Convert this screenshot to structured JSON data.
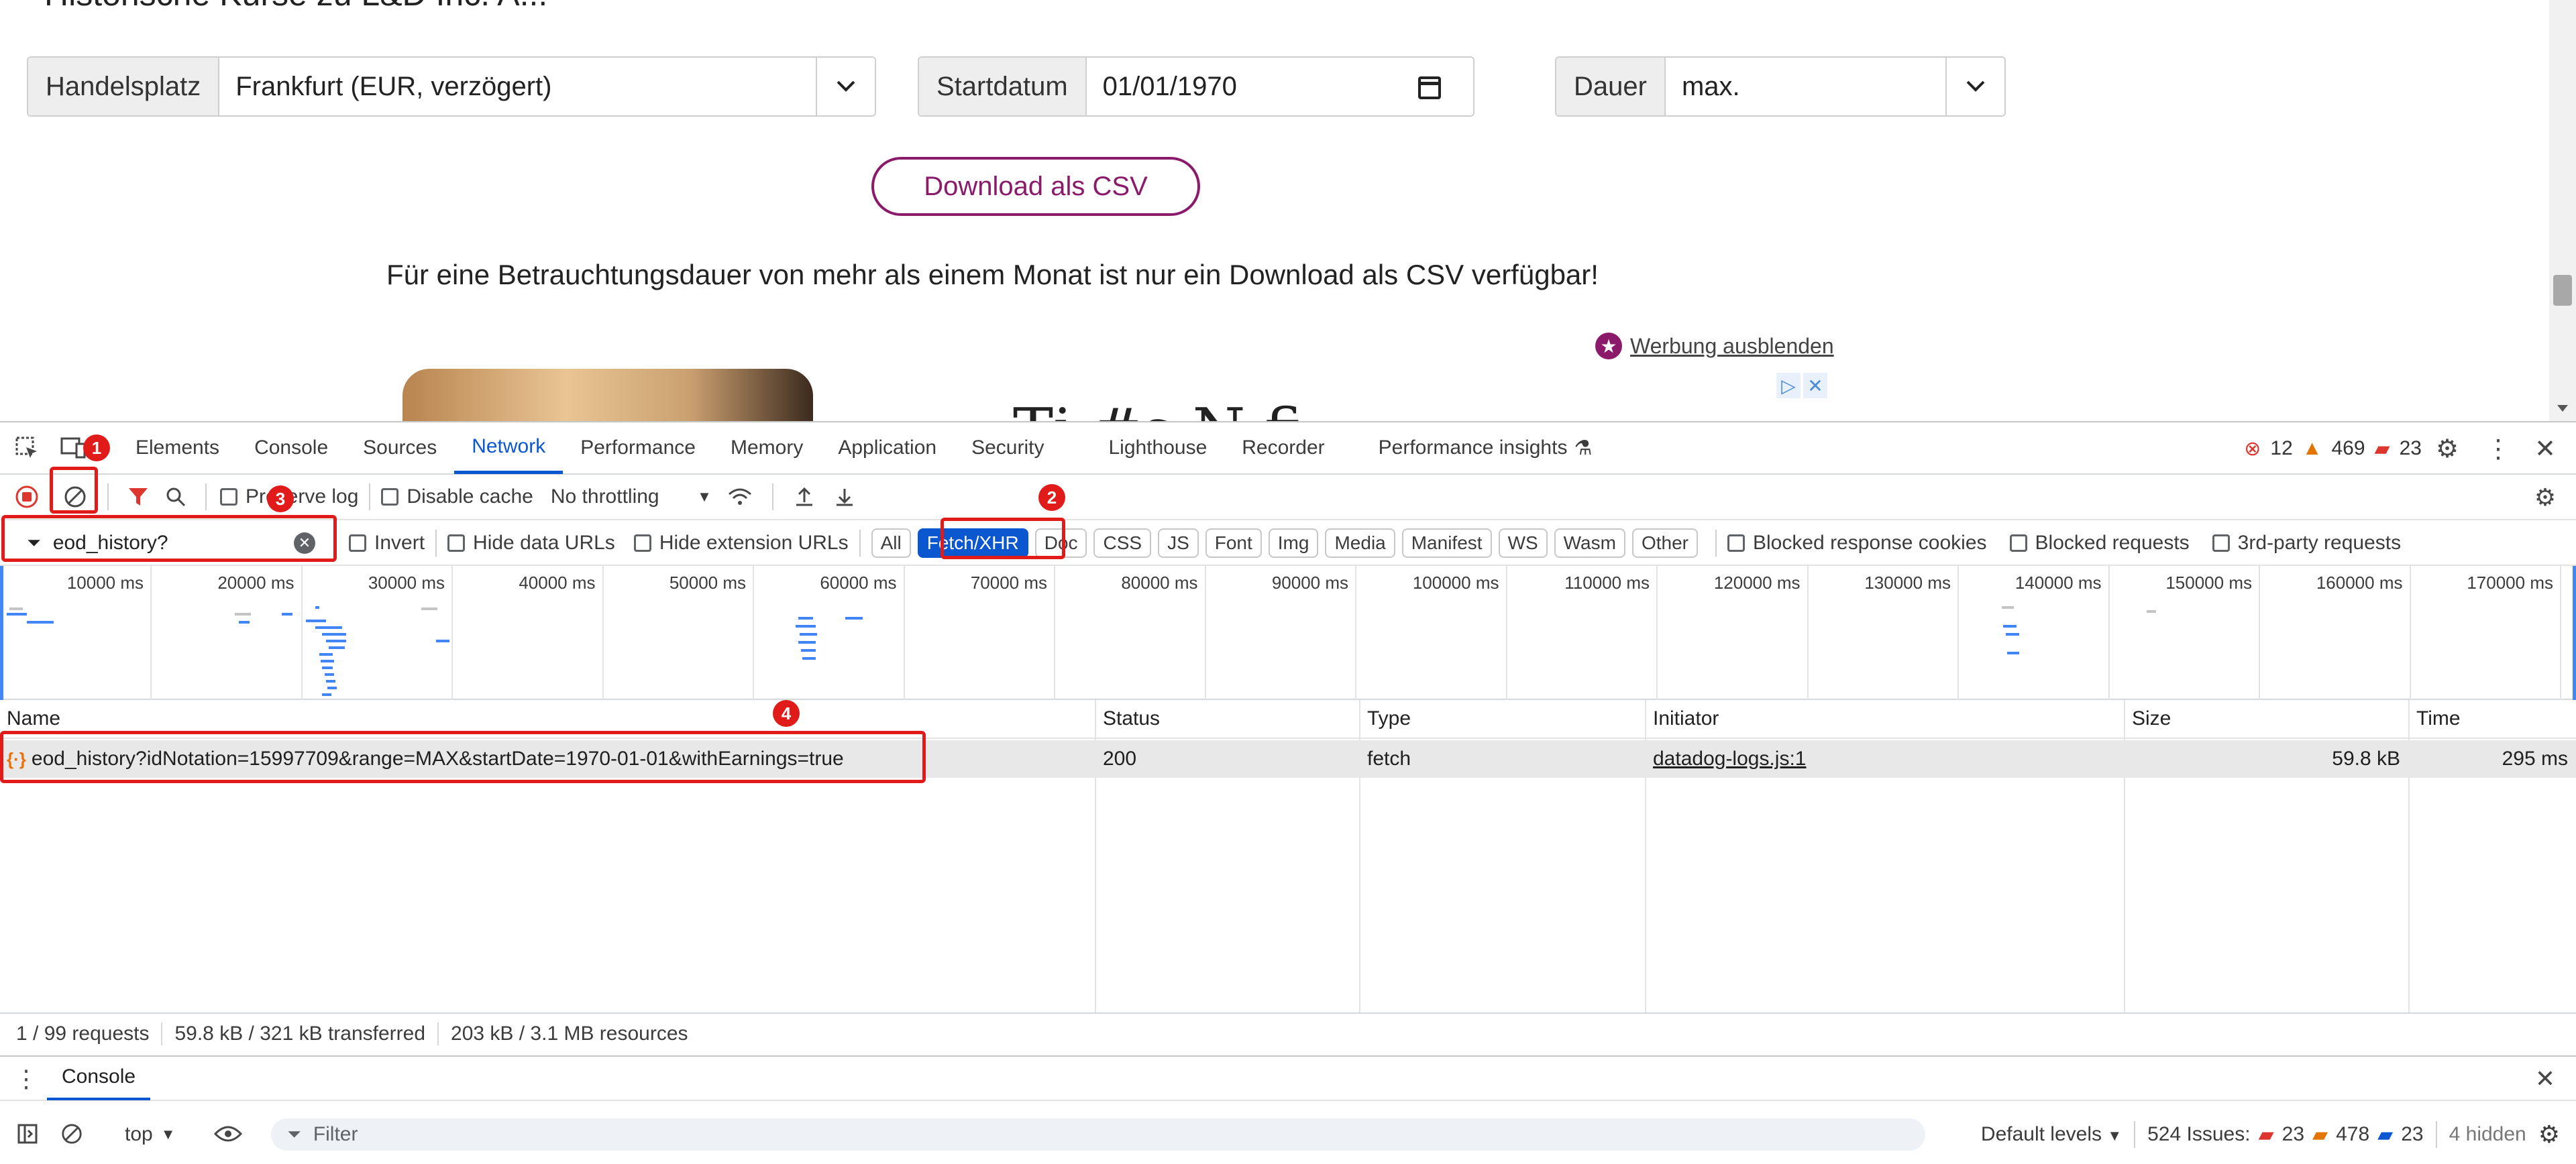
{
  "webpage": {
    "heading": "Historische Kurse zu L&D Inc. A...",
    "exchange": {
      "label": "Handelsplatz",
      "value": "Frankfurt (EUR, verzögert)"
    },
    "start_date": {
      "label": "Startdatum",
      "value": "01/01/1970"
    },
    "duration": {
      "label": "Dauer",
      "value": "max."
    },
    "download_button": "Download als CSV",
    "info_text": "Für eine Betrauchtungsdauer von mehr als einem Monat ist nur ein Download als CSV verfügbar!",
    "ad_hide_link": "Werbung ausblenden",
    "ad_partial_text": "Ti   #s  N   fi"
  },
  "devtools": {
    "tabs": [
      "Elements",
      "Console",
      "Sources",
      "Network",
      "Performance",
      "Memory",
      "Application",
      "Security",
      "Lighthouse",
      "Recorder",
      "Performance insights"
    ],
    "active_tab": "Network",
    "counts": {
      "errors": "12",
      "warnings": "469",
      "messages": "23"
    },
    "toolbar": {
      "preserve_log": "Preserve log",
      "disable_cache": "Disable cache",
      "throttling": "No throttling"
    },
    "filter": {
      "value": "eod_history?",
      "invert": "Invert",
      "hide_data_urls": "Hide data URLs",
      "hide_extension_urls": "Hide extension URLs",
      "types": [
        "All",
        "Fetch/XHR",
        "Doc",
        "CSS",
        "JS",
        "Font",
        "Img",
        "Media",
        "Manifest",
        "WS",
        "Wasm",
        "Other"
      ],
      "active_type": "Fetch/XHR",
      "blocked_response_cookies": "Blocked response cookies",
      "blocked_requests": "Blocked requests",
      "third_party_requests": "3rd-party requests"
    },
    "overview_ticks": [
      "10000 ms",
      "20000 ms",
      "30000 ms",
      "40000 ms",
      "50000 ms",
      "60000 ms",
      "70000 ms",
      "80000 ms",
      "90000 ms",
      "100000 ms",
      "110000 ms",
      "120000 ms",
      "130000 ms",
      "140000 ms",
      "150000 ms",
      "160000 ms",
      "170000 ms"
    ],
    "table": {
      "headers": {
        "name": "Name",
        "status": "Status",
        "type": "Type",
        "initiator": "Initiator",
        "size": "Size",
        "time": "Time"
      },
      "rows": [
        {
          "name": "eod_history?idNotation=15997709&range=MAX&startDate=1970-01-01&withEarnings=true",
          "status": "200",
          "type": "fetch",
          "initiator": "datadog-logs.js:1",
          "size": "59.8 kB",
          "time": "295 ms"
        }
      ]
    },
    "status_bar": {
      "requests": "1 / 99 requests",
      "transferred": "59.8 kB / 321 kB transferred",
      "resources": "203 kB / 3.1 MB resources"
    },
    "drawer": {
      "tab": "Console",
      "context": "top",
      "filter_placeholder": "Filter",
      "levels": "Default levels",
      "issues_label": "524 Issues:",
      "issues": {
        "errors": "23",
        "warnings": "478",
        "info": "23"
      },
      "hidden": "4 hidden"
    }
  },
  "annotations": [
    "1",
    "2",
    "3",
    "4"
  ],
  "colors": {
    "accent": "#0b57d0",
    "brand": "#8b1a6b",
    "annotation": "#e11a1a"
  }
}
